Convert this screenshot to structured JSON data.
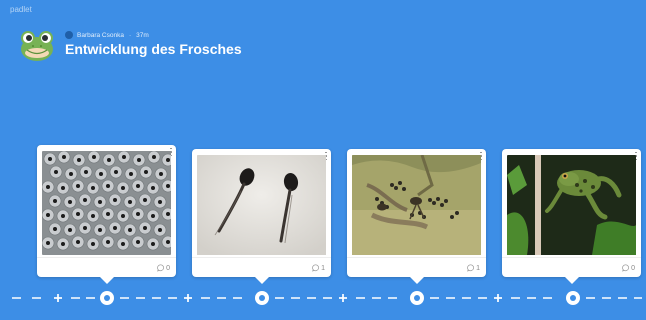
{
  "app": {
    "brand": "padlet"
  },
  "board": {
    "author": "Barbara Csonka",
    "time": "37m",
    "title": "Entwicklung des Frosches",
    "avatar_icon": "frog-emoji-icon"
  },
  "colors": {
    "background": "#3d8ee6",
    "card": "#ffffff"
  },
  "posts": [
    {
      "image": "frog-spawn-photo",
      "comments": "0"
    },
    {
      "image": "tadpoles-photo",
      "comments": "1"
    },
    {
      "image": "tadpoles-with-legs-photo",
      "comments": "1"
    },
    {
      "image": "frog-photo",
      "comments": "0"
    }
  ]
}
